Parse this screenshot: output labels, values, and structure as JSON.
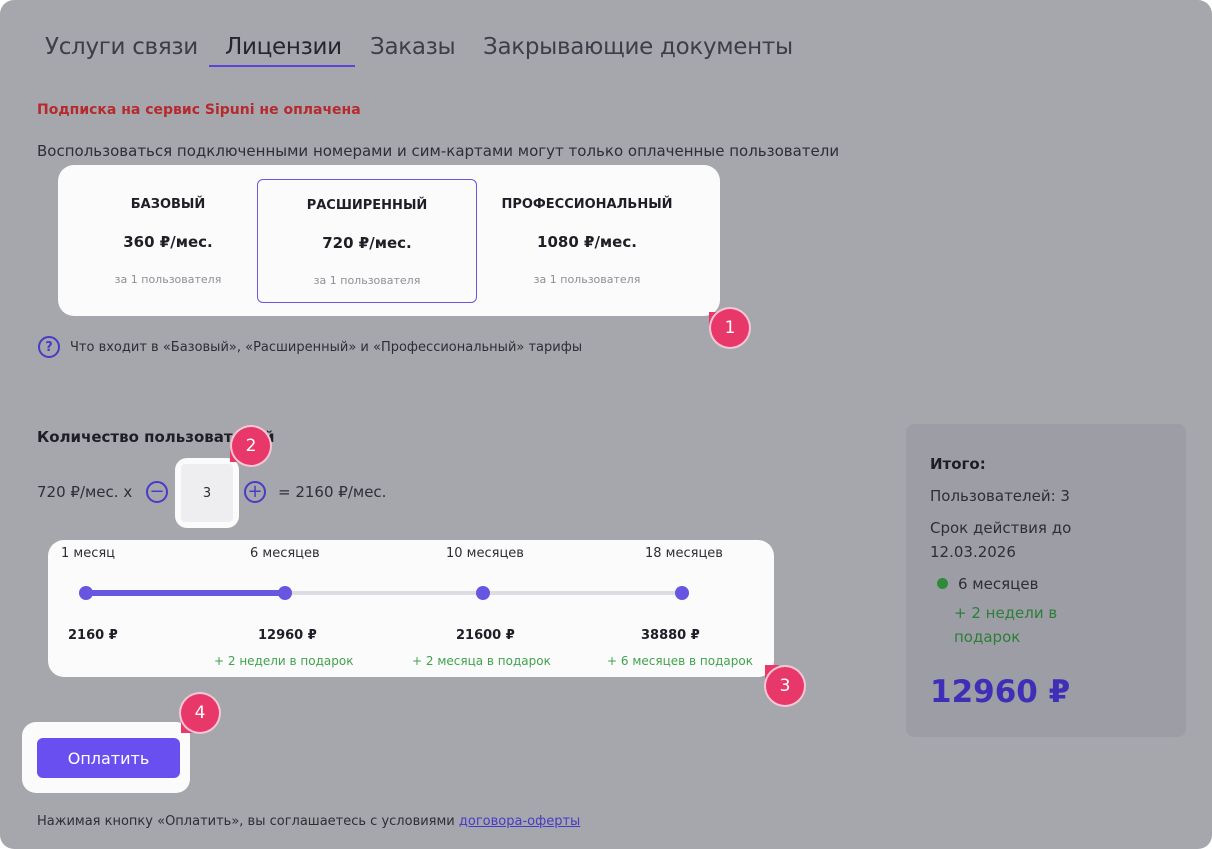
{
  "tabs": [
    {
      "label": "Услуги связи"
    },
    {
      "label": "Лицензии",
      "active": true
    },
    {
      "label": "Заказы"
    },
    {
      "label": "Закрывающие документы"
    }
  ],
  "warning": "Подписка на сервис Sipuni не оплачена",
  "info": "Воспользоваться подключенными номерами и сим-картами могут только оплаченные пользователи",
  "plans": [
    {
      "name": "БАЗОВЫЙ",
      "price": "360 ₽/мес.",
      "note": "за 1 пользователя",
      "selected": false
    },
    {
      "name": "РАСШИРЕННЫЙ",
      "price": "720 ₽/мес.",
      "note": "за 1 пользователя",
      "selected": true
    },
    {
      "name": "ПРОФЕССИОНАЛЬНЫЙ",
      "price": "1080 ₽/мес.",
      "note": "за 1 пользователя",
      "selected": false
    }
  ],
  "help": {
    "icon": "question-circle-icon",
    "text": "Что входит в «Базовый», «Расширенный» и «Профессиональный» тарифы"
  },
  "users": {
    "title": "Количество пользователей",
    "price_per": "720 ₽/мес. x",
    "minus_icon": "minus-circle-icon",
    "quantity": "3",
    "plus_icon": "plus-circle-icon",
    "result": "= 2160 ₽/мес."
  },
  "periods": {
    "selected_index": 1,
    "items": [
      {
        "label": "1 месяц",
        "price": "2160 ₽",
        "bonus": ""
      },
      {
        "label": "6 месяцев",
        "price": "12960 ₽",
        "bonus": "+ 2 недели в подарок"
      },
      {
        "label": "10 месяцев",
        "price": "21600 ₽",
        "bonus": "+ 2 месяца в подарок"
      },
      {
        "label": "18 месяцев",
        "price": "38880 ₽",
        "bonus": "+ 6 месяцев в подарок"
      }
    ]
  },
  "summary": {
    "title": "Итого:",
    "users": "Пользователей: 3",
    "valid_label": "Срок действия до",
    "valid_date": "12.03.2026",
    "period": "6 месяцев",
    "gift_line1": "+ 2 недели в",
    "gift_line2": "подарок",
    "total": "12960 ₽"
  },
  "pay_label": "Оплатить",
  "footer": {
    "text": "Нажимая кнопку «Оплатить», вы соглашаетесь с условиями ",
    "link": "договора-оферты"
  },
  "badges": [
    "1",
    "2",
    "3",
    "4"
  ],
  "colors": {
    "accent": "#6a4ff0",
    "warning": "#b62a2e",
    "bonus": "#3fa34d",
    "badge": "#e8386a",
    "overlay": "#a6a6ad"
  }
}
